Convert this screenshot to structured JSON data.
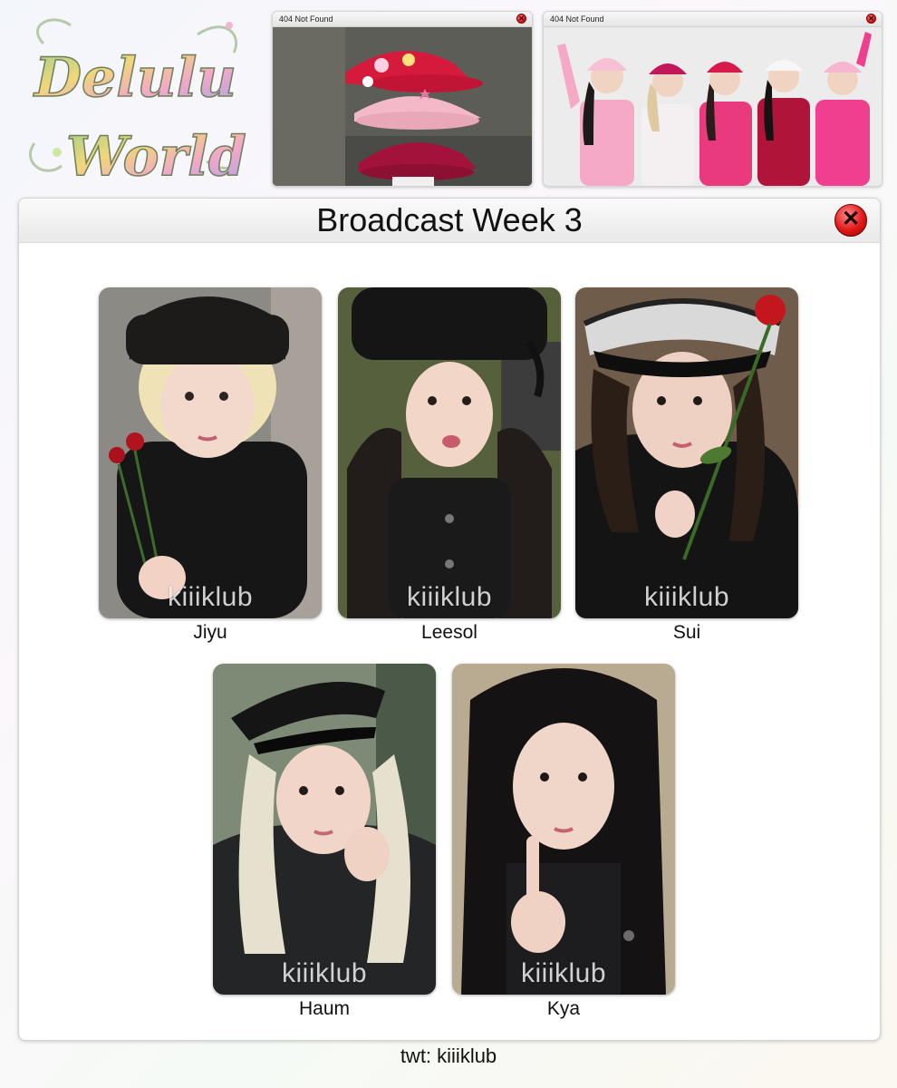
{
  "logo": {
    "line1": "Delulu",
    "line2": "World"
  },
  "top_windows": [
    {
      "title": "404 Not Found",
      "close_label": "✕"
    },
    {
      "title": "404 Not Found",
      "close_label": "✕"
    }
  ],
  "main_window": {
    "title": "Broadcast Week 3",
    "close_label": "✕"
  },
  "cards": [
    {
      "name": "Jiyu",
      "watermark": "kiiiklub"
    },
    {
      "name": "Leesol",
      "watermark": "kiiiklub"
    },
    {
      "name": "Sui",
      "watermark": "kiiiklub"
    },
    {
      "name": "Haum",
      "watermark": "kiiiklub"
    },
    {
      "name": "Kya",
      "watermark": "kiiiklub"
    }
  ],
  "footer": "twt: kiiiklub",
  "colors": {
    "close_red": "#e01818",
    "hat_red": "#d61a3c",
    "hat_pink": "#ee3a8c"
  }
}
